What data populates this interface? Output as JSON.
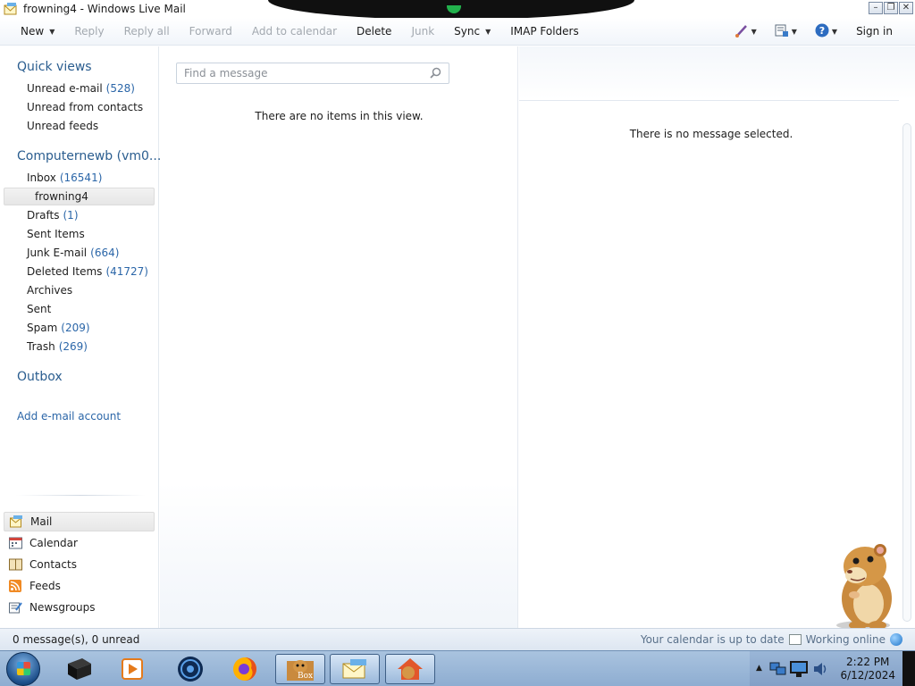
{
  "window": {
    "title": "frowning4 - Windows Live Mail"
  },
  "toolbar": {
    "new_label": "New",
    "reply_label": "Reply",
    "reply_all_label": "Reply all",
    "forward_label": "Forward",
    "add_to_calendar_label": "Add to calendar",
    "delete_label": "Delete",
    "junk_label": "Junk",
    "sync_label": "Sync",
    "imap_folders_label": "IMAP Folders",
    "sign_in_label": "Sign in"
  },
  "sidebar": {
    "quick_views_heading": "Quick views",
    "quick_views": [
      {
        "label": "Unread e-mail",
        "count": "(528)"
      },
      {
        "label": "Unread from contacts",
        "count": ""
      },
      {
        "label": "Unread feeds",
        "count": ""
      }
    ],
    "account_heading": "Computernewb (vm0...",
    "folders": [
      {
        "label": "Inbox",
        "count": "(16541)"
      },
      {
        "label": "frowning4",
        "count": ""
      },
      {
        "label": "Drafts",
        "count": "(1)"
      },
      {
        "label": "Sent Items",
        "count": ""
      },
      {
        "label": "Junk E-mail",
        "count": "(664)"
      },
      {
        "label": "Deleted Items",
        "count": "(41727)"
      },
      {
        "label": "Archives",
        "count": ""
      },
      {
        "label": "Sent",
        "count": ""
      },
      {
        "label": "Spam",
        "count": "(209)"
      },
      {
        "label": "Trash",
        "count": "(269)"
      }
    ],
    "selected_folder": "frowning4",
    "outbox_heading": "Outbox",
    "add_account_label": "Add e-mail account",
    "modules": [
      {
        "label": "Mail",
        "icon": "mail-icon"
      },
      {
        "label": "Calendar",
        "icon": "calendar-icon"
      },
      {
        "label": "Contacts",
        "icon": "contacts-icon"
      },
      {
        "label": "Feeds",
        "icon": "feeds-icon"
      },
      {
        "label": "Newsgroups",
        "icon": "newsgroups-icon"
      }
    ],
    "active_module": "Mail"
  },
  "message_list": {
    "search_placeholder": "Find a message",
    "empty_text": "There are no items in this view."
  },
  "reading_pane": {
    "empty_text": "There is no message selected."
  },
  "status_bar": {
    "left_text": "0 message(s), 0 unread",
    "calendar_text": "Your calendar is up to date",
    "online_text": "Working online"
  },
  "taskbar": {
    "clock_time": "2:22 PM",
    "clock_date": "6/12/2024",
    "box_app_label": "Box"
  },
  "colors": {
    "accent_link": "#2b66a8",
    "section_heading": "#2a5d8f",
    "taskbar": "#9ab6d7"
  }
}
